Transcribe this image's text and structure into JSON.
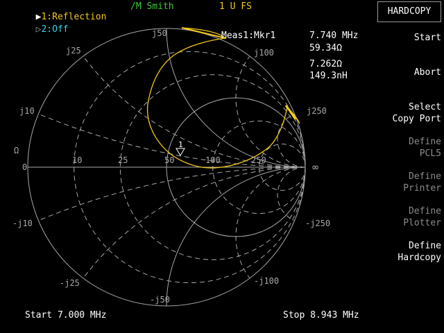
{
  "header": {
    "ch1_label": "1:Reflection",
    "format": "/M Smith",
    "scale": "1 U FS",
    "ch2_label": "2:Off"
  },
  "marker": {
    "title": "Meas1:Mkr1",
    "frequency": "7.740 MHz",
    "resistance": "59.34Ω",
    "reactance": "7.262Ω",
    "inductance": "149.3nH",
    "number": "1"
  },
  "footer": {
    "start": "Start 7.000 MHz",
    "stop": "Stop 8.943 MHz"
  },
  "softkeys": {
    "title": "HARDCOPY",
    "start": "Start",
    "abort": "Abort",
    "select_line1": "Select",
    "select_line2": "Copy Port",
    "pcl5_line1": "Define",
    "pcl5_line2": "PCL5",
    "printer_line1": "Define",
    "printer_line2": "Printer",
    "plotter_line1": "Define",
    "plotter_line2": "Plotter",
    "hardcopy_line1": "Define",
    "hardcopy_line2": "Hardcopy"
  },
  "chart_data": {
    "type": "smith",
    "z0": 50,
    "resistance_circles": [
      10,
      25,
      50,
      100,
      250
    ],
    "reactance_arcs": [
      10,
      25,
      50,
      100,
      250
    ],
    "labels": {
      "r": [
        "10",
        "25",
        "50",
        "100",
        "250"
      ],
      "jpos": [
        "j10",
        "j25",
        "j50",
        "j100",
        "j250"
      ],
      "jneg": [
        "-j10",
        "-j25",
        "-j50",
        "-j100",
        "-j250"
      ],
      "zero": "0",
      "inf": "∞",
      "ohm": "Ω"
    },
    "trace_color": "#f2c81e"
  }
}
